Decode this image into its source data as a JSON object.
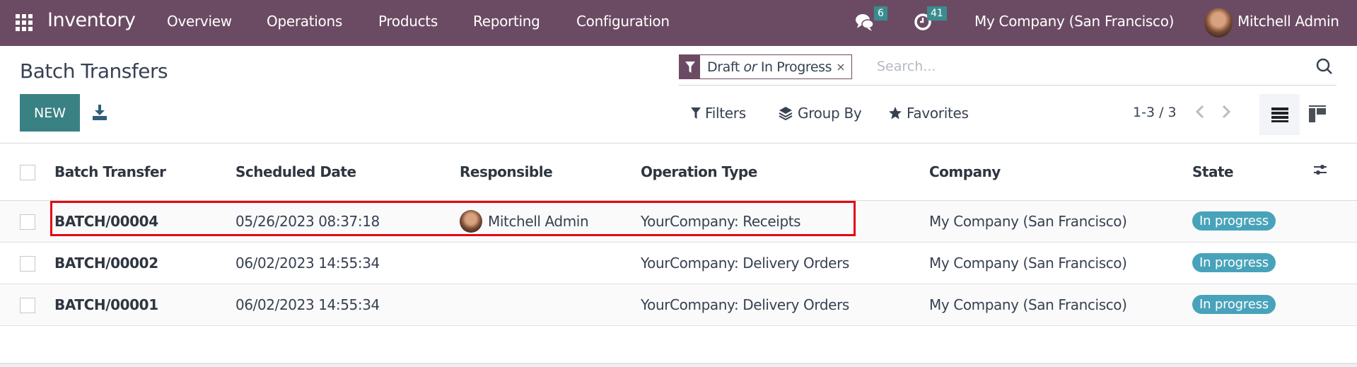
{
  "navbar": {
    "app_name": "Inventory",
    "menu": [
      "Overview",
      "Operations",
      "Products",
      "Reporting",
      "Configuration"
    ],
    "messages_count": "6",
    "activities_count": "41",
    "company": "My Company (San Francisco)",
    "user": "Mitchell Admin"
  },
  "page": {
    "title": "Batch Transfers",
    "new_label": "NEW"
  },
  "search": {
    "facet_a": "Draft",
    "facet_or": "or",
    "facet_b": "In Progress",
    "facet_remove": "×",
    "placeholder": "Search..."
  },
  "controls": {
    "filters": "Filters",
    "group_by": "Group By",
    "favorites": "Favorites",
    "pager": "1-3 / 3"
  },
  "table": {
    "headers": [
      "Batch Transfer",
      "Scheduled Date",
      "Responsible",
      "Operation Type",
      "Company",
      "State"
    ],
    "rows": [
      {
        "name": "BATCH/00004",
        "date": "05/26/2023 08:37:18",
        "responsible": "Mitchell Admin",
        "operation_type": "YourCompany: Receipts",
        "company": "My Company (San Francisco)",
        "state": "In progress"
      },
      {
        "name": "BATCH/00002",
        "date": "06/02/2023 14:55:34",
        "responsible": "",
        "operation_type": "YourCompany: Delivery Orders",
        "company": "My Company (San Francisco)",
        "state": "In progress"
      },
      {
        "name": "BATCH/00001",
        "date": "06/02/2023 14:55:34",
        "responsible": "",
        "operation_type": "YourCompany: Delivery Orders",
        "company": "My Company (San Francisco)",
        "state": "In progress"
      }
    ]
  },
  "colors": {
    "navbar": "#6b4b63",
    "primary_button": "#3a8183",
    "state_badge": "#48a3ba",
    "highlight": "#e30613"
  }
}
